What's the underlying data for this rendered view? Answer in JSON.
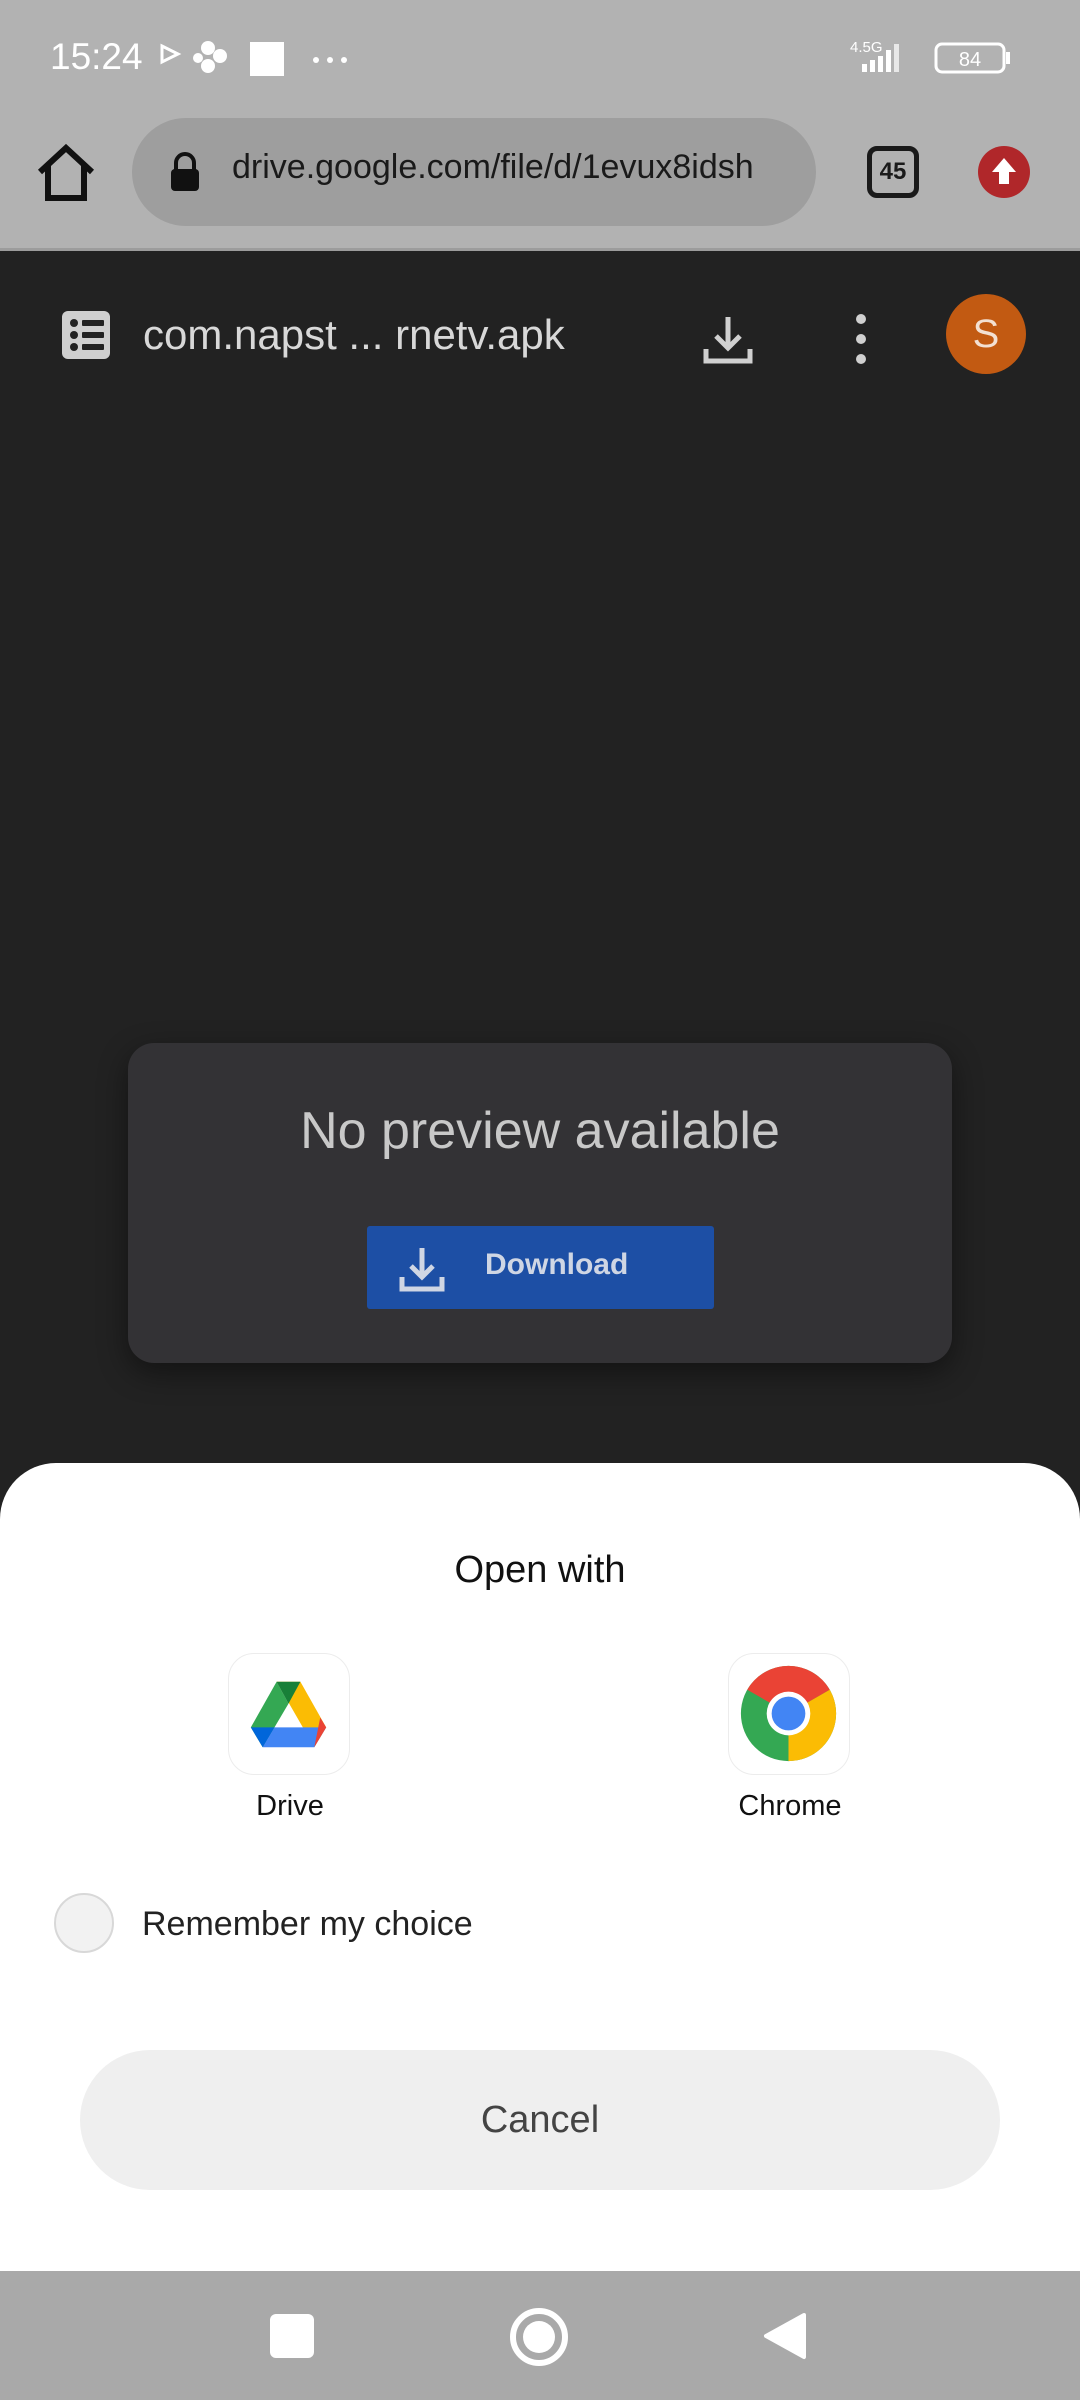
{
  "status_bar": {
    "time": "15:24",
    "network": "4.5G",
    "battery": "84",
    "icons": [
      "play-icon",
      "app-notification-icon",
      "square-notification-icon",
      "more-dots-icon",
      "signal-icon",
      "battery-icon"
    ]
  },
  "browser": {
    "url": "drive.google.com/file/d/1evux8idsh",
    "tab_count": "45",
    "colors": {
      "toolbar": "#b2b2b2",
      "omnibox": "#9e9e9e",
      "update_badge": "#b0272a"
    }
  },
  "drive": {
    "file_name": "com.napst ... rnetv.apk",
    "avatar_letter": "S",
    "avatar_color": "#c25a12",
    "preview_message": "No preview available",
    "download_label": "Download",
    "download_button_color": "#1d4fa5"
  },
  "sheet": {
    "title": "Open with",
    "apps": [
      {
        "label": "Drive",
        "icon": "google-drive-icon"
      },
      {
        "label": "Chrome",
        "icon": "chrome-icon"
      }
    ],
    "remember_label": "Remember my choice",
    "remember_checked": false,
    "cancel_label": "Cancel"
  },
  "nav_bar": {
    "buttons": [
      "recents-button",
      "home-button",
      "back-button"
    ]
  }
}
